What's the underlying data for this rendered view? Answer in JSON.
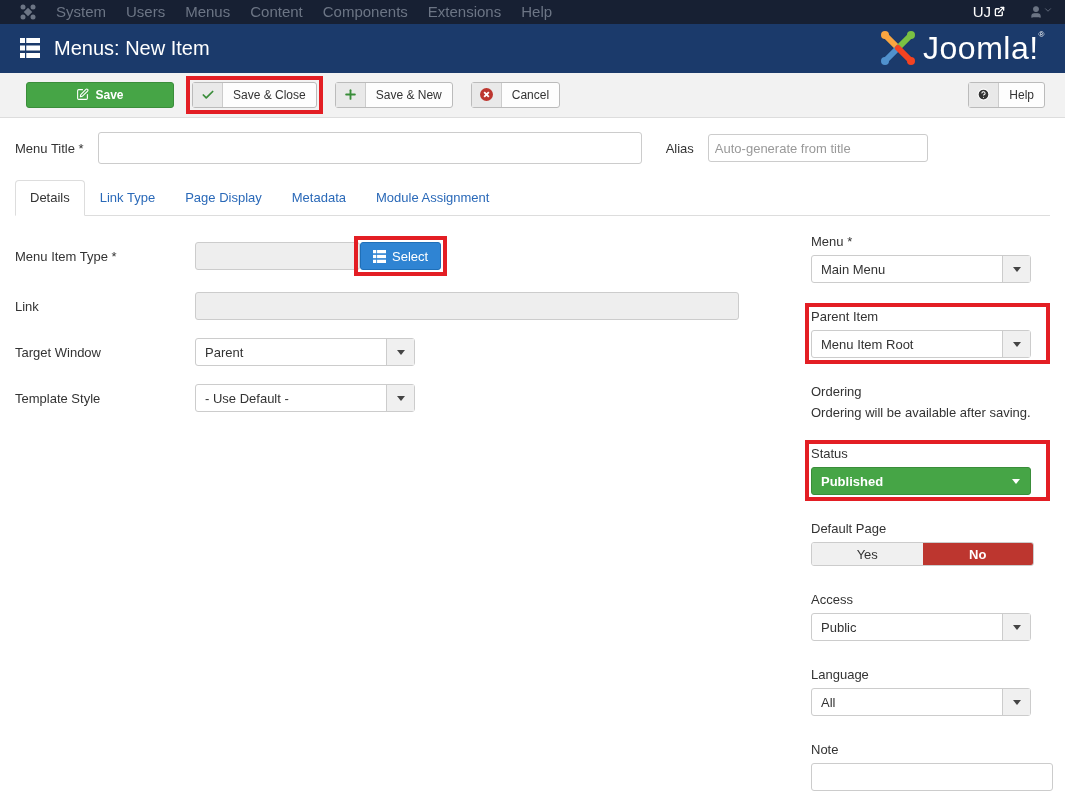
{
  "top_menu": {
    "items": [
      "System",
      "Users",
      "Menus",
      "Content",
      "Components",
      "Extensions",
      "Help"
    ],
    "user": "UJ"
  },
  "header": {
    "title": "Menus: New Item",
    "logo": "Joomla!$^{®}$"
  },
  "toolbar": {
    "buttons": [
      {
        "kind": "save",
        "label": "Save",
        "highlighted": false
      },
      {
        "kind": "check",
        "label": "Save & Close",
        "highlighted": true
      },
      {
        "kind": "plus",
        "label": "Save & New",
        "highlighted": false
      },
      {
        "kind": "cancel",
        "label": "Cancel",
        "highlighted": false
      }
    ],
    "help": "Help"
  },
  "title_field": {
    "label": "Menu Title *"
  },
  "alias_field": {
    "label": "Alias",
    "placeholder": "Auto-generate from title"
  },
  "tabs": [
    {
      "label": "Details",
      "selected": true
    },
    {
      "label": "Link Type",
      "selected": false
    },
    {
      "label": "Page Display",
      "selected": false
    },
    {
      "label": "Metadata",
      "selected": false
    },
    {
      "label": "Module Assignment",
      "selected": false
    }
  ],
  "left_fields": [
    {
      "kind": "picker",
      "label": "Menu Item Type *",
      "button": "Select",
      "highlighted": true
    },
    {
      "kind": "readonly",
      "label": "Link"
    },
    {
      "kind": "dropdown",
      "label": "Target Window",
      "value": "Parent"
    },
    {
      "kind": "dropdown",
      "label": "Template Style",
      "value": "- Use Default -"
    }
  ],
  "right_fields": [
    {
      "kind": "dropdown",
      "label": "Menu *",
      "value": "Main Menu",
      "highlighted": false
    },
    {
      "kind": "dropdown",
      "label": "Parent Item",
      "value": "Menu Item Root",
      "highlighted": true
    },
    {
      "kind": "note",
      "label": "Ordering",
      "text": "Ordering will be available after saving.",
      "highlighted": false
    },
    {
      "kind": "status",
      "label": "Status",
      "value": "Published",
      "highlighted": true
    },
    {
      "kind": "toggle",
      "label": "Default Page",
      "highlighted": false,
      "options": [
        {
          "label": "Yes",
          "selected": false
        },
        {
          "label": "No",
          "selected": true
        }
      ]
    },
    {
      "kind": "dropdown",
      "label": "Access",
      "value": "Public",
      "highlighted": false
    },
    {
      "kind": "dropdown",
      "label": "Language",
      "value": "All",
      "highlighted": false
    },
    {
      "kind": "text",
      "label": "Note",
      "highlighted": false
    }
  ]
}
